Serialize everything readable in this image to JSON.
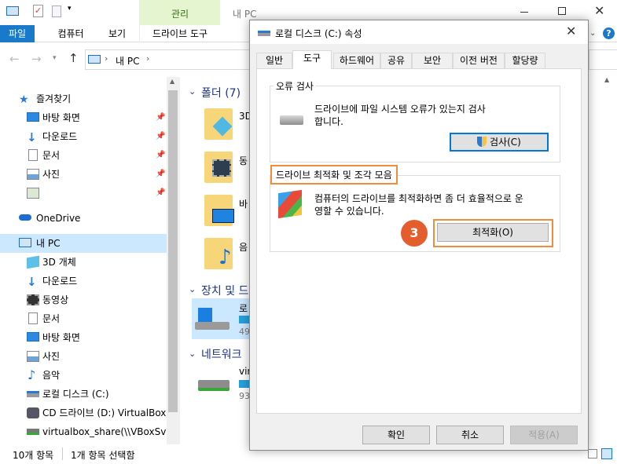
{
  "explorer": {
    "title": "내 PC",
    "ribbon": {
      "context_tab": "관리",
      "tabs": [
        "파일",
        "컴퓨터",
        "보기",
        "드라이브 도구"
      ]
    },
    "address": {
      "path_label": "내 PC"
    },
    "nav": {
      "quick_access": "즐겨찾기",
      "quick_items": [
        "바탕 화면",
        "다운로드",
        "문서",
        "사진"
      ],
      "onedrive": "OneDrive",
      "this_pc": "내 PC",
      "pc_items": [
        "3D 개체",
        "다운로드",
        "동영상",
        "문서",
        "바탕 화면",
        "사진",
        "음악",
        "로컬 디스크 (C:)",
        "CD 드라이브 (D:) VirtualBox G",
        "virtualbox_share(\\\\VBoxSvr)"
      ]
    },
    "content": {
      "folders_header": "폴더 (7)",
      "folder_labels": [
        "3D",
        "동",
        "바",
        "음"
      ],
      "devices_header": "장치 및 드",
      "device_label": "로",
      "device_size": "49",
      "network_header": "네트워크",
      "network_label": "vir",
      "network_size": "93"
    },
    "status": {
      "count": "10개 항목",
      "selected": "1개 항목 선택함"
    }
  },
  "dialog": {
    "title": "로컬 디스크 (C:) 속성",
    "tabs": [
      "일반",
      "도구",
      "하드웨어",
      "공유",
      "보안",
      "이전 버전",
      "할당량"
    ],
    "active_tab": "도구",
    "error_check": {
      "label": "오류 검사",
      "description_1": "드라이브에 파일 시스템 오류가 있는지 검사",
      "description_2": "합니다.",
      "button": "검사(C)"
    },
    "optimize": {
      "label": "드라이브 최적화 및 조각 모음",
      "description_1": "컴퓨터의 드라이브를 최적화하면 좀 더 효율적으로 운",
      "description_2": "영할 수 있습니다.",
      "button": "최적화(O)",
      "step_badge": "3"
    },
    "buttons": {
      "ok": "확인",
      "cancel": "취소",
      "apply": "적용(A)"
    }
  },
  "colors": {
    "accent": "#1979ca",
    "highlight": "#f08c3a",
    "badge": "#e35d2d",
    "ribbon_context": "#e4f5cf"
  }
}
